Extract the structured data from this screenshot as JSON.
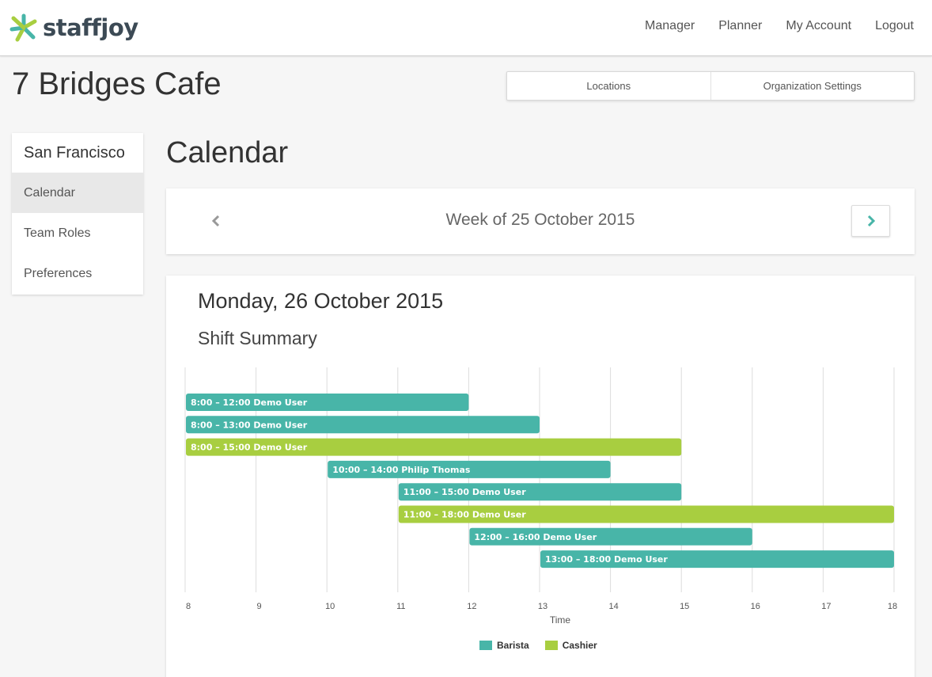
{
  "nav": {
    "brand": "staffjoy",
    "links": [
      "Manager",
      "Planner",
      "My Account",
      "Logout"
    ]
  },
  "org": {
    "name": "7 Bridges Cafe",
    "tabs": [
      "Locations",
      "Organization Settings"
    ]
  },
  "sidebar": {
    "location": "San Francisco",
    "items": [
      "Calendar",
      "Team Roles",
      "Preferences"
    ],
    "active": "Calendar"
  },
  "main": {
    "title": "Calendar",
    "week_label": "Week of 25 October 2015",
    "day_title": "Monday, 26 October 2015",
    "summary_title": "Shift Summary"
  },
  "colors": {
    "barista": "#48b5a8",
    "cashier": "#a8ce40",
    "chevron": "#48b5a8"
  },
  "chart_data": {
    "type": "bar",
    "xlabel": "Time",
    "xlim": [
      8,
      18
    ],
    "xticks": [
      "8",
      "9",
      "10",
      "11",
      "12",
      "13",
      "14",
      "15",
      "16",
      "17",
      "18"
    ],
    "series": [
      {
        "name": "Barista",
        "color": "#48b5a8"
      },
      {
        "name": "Cashier",
        "color": "#a8ce40"
      }
    ],
    "shifts": [
      {
        "start": 8,
        "end": 12,
        "label": "8:00 – 12:00 Demo User",
        "role": "Barista"
      },
      {
        "start": 8,
        "end": 13,
        "label": "8:00 – 13:00 Demo User",
        "role": "Barista"
      },
      {
        "start": 8,
        "end": 15,
        "label": "8:00 – 15:00 Demo User",
        "role": "Cashier"
      },
      {
        "start": 10,
        "end": 14,
        "label": "10:00 – 14:00 Philip Thomas",
        "role": "Barista"
      },
      {
        "start": 11,
        "end": 15,
        "label": "11:00 – 15:00 Demo User",
        "role": "Barista"
      },
      {
        "start": 11,
        "end": 18,
        "label": "11:00 – 18:00 Demo User",
        "role": "Cashier"
      },
      {
        "start": 12,
        "end": 16,
        "label": "12:00 – 16:00 Demo User",
        "role": "Barista"
      },
      {
        "start": 13,
        "end": 18,
        "label": "13:00 – 18:00 Demo User",
        "role": "Barista"
      }
    ]
  }
}
